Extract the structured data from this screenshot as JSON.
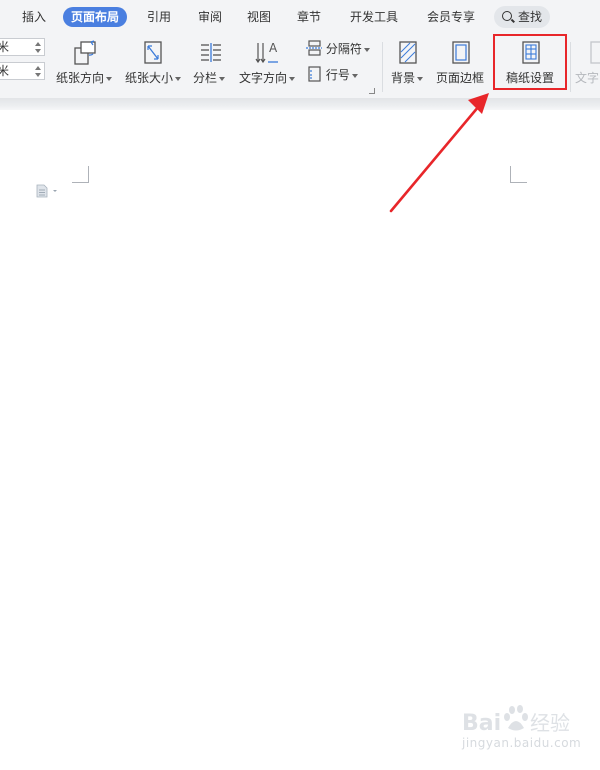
{
  "tabs": [
    {
      "label": "插入",
      "active": false
    },
    {
      "label": "页面布局",
      "active": true
    },
    {
      "label": "引用",
      "active": false
    },
    {
      "label": "审阅",
      "active": false
    },
    {
      "label": "视图",
      "active": false
    },
    {
      "label": "章节",
      "active": false
    },
    {
      "label": "开发工具",
      "active": false
    },
    {
      "label": "会员专享",
      "active": false
    }
  ],
  "search": {
    "label": "查找",
    "icon": "search-icon"
  },
  "ribbon": {
    "spinners": [
      {
        "value": "米"
      },
      {
        "value": "米"
      }
    ],
    "buttons": [
      {
        "label": "纸张方向",
        "icon": "orientation-icon",
        "dropdown": true
      },
      {
        "label": "纸张大小",
        "icon": "paper-size-icon",
        "dropdown": true
      },
      {
        "label": "分栏",
        "icon": "columns-icon",
        "dropdown": true
      },
      {
        "label": "文字方向",
        "icon": "text-direction-icon",
        "dropdown": true
      },
      {
        "label": "背景",
        "icon": "background-icon",
        "dropdown": true
      },
      {
        "label": "页面边框",
        "icon": "page-border-icon",
        "dropdown": false
      },
      {
        "label": "稿纸设置",
        "icon": "manuscript-icon",
        "dropdown": false
      },
      {
        "label": "文字",
        "icon": "text-icon",
        "dropdown": false,
        "disabled": true
      }
    ],
    "small_buttons": [
      {
        "label": "分隔符",
        "icon": "separator-icon"
      },
      {
        "label": "行号",
        "icon": "line-number-icon"
      }
    ]
  },
  "watermark": {
    "text": "jingyan.baidu.com",
    "logo_text": "Baidu 经验"
  },
  "colors": {
    "accent": "#4a7fe0",
    "highlight": "#e8262a",
    "ribbon_bg": "#f3f4f6"
  }
}
